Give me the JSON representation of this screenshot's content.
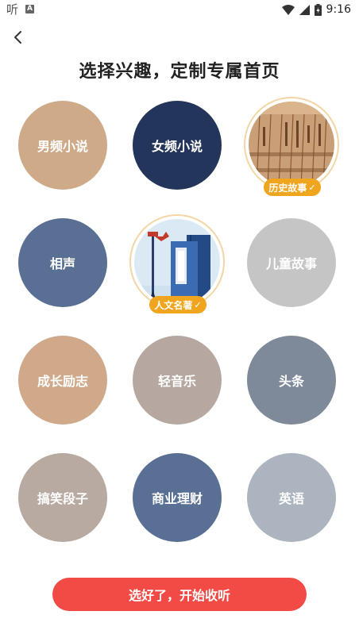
{
  "status_bar": {
    "app_glyph": "听",
    "notice_glyph": "A",
    "time": "9:16",
    "icons": [
      "wifi-icon",
      "signal-icon",
      "battery-icon"
    ]
  },
  "header": {
    "back_icon": "chevron-left-icon",
    "title": "选择兴趣，定制专属首页"
  },
  "topics": [
    {
      "id": "male-novel",
      "label": "男频小说",
      "color": "#cfaa88",
      "selected": false
    },
    {
      "id": "female-novel",
      "label": "女频小说",
      "color": "#23355a",
      "selected": false
    },
    {
      "id": "history-story",
      "label": "历史故事",
      "selected": true,
      "image": "bamboo-slips"
    },
    {
      "id": "crosstalk",
      "label": "相声",
      "color": "#596f94",
      "selected": false
    },
    {
      "id": "humanities-classics",
      "label": "人文名著",
      "selected": true,
      "image": "books-brush"
    },
    {
      "id": "children-story",
      "label": "儿童故事",
      "color": "#c6c5c5",
      "selected": false
    },
    {
      "id": "growth-inspiration",
      "label": "成长励志",
      "color": "#cfa98a",
      "selected": false
    },
    {
      "id": "light-music",
      "label": "轻音乐",
      "color": "#b6a8a0",
      "selected": false
    },
    {
      "id": "headlines",
      "label": "头条",
      "color": "#7e8a9a",
      "selected": false
    },
    {
      "id": "funny-jokes",
      "label": "搞笑段子",
      "color": "#b8a9a1",
      "selected": false
    },
    {
      "id": "business-finance",
      "label": "商业理财",
      "color": "#596f94",
      "selected": false
    },
    {
      "id": "english",
      "label": "英语",
      "color": "#acb4bf",
      "selected": false
    }
  ],
  "badge_check": "✓",
  "cta": {
    "label": "选好了，开始收听"
  },
  "colors": {
    "accent": "#f24a45",
    "badge": "#f0a51e"
  }
}
